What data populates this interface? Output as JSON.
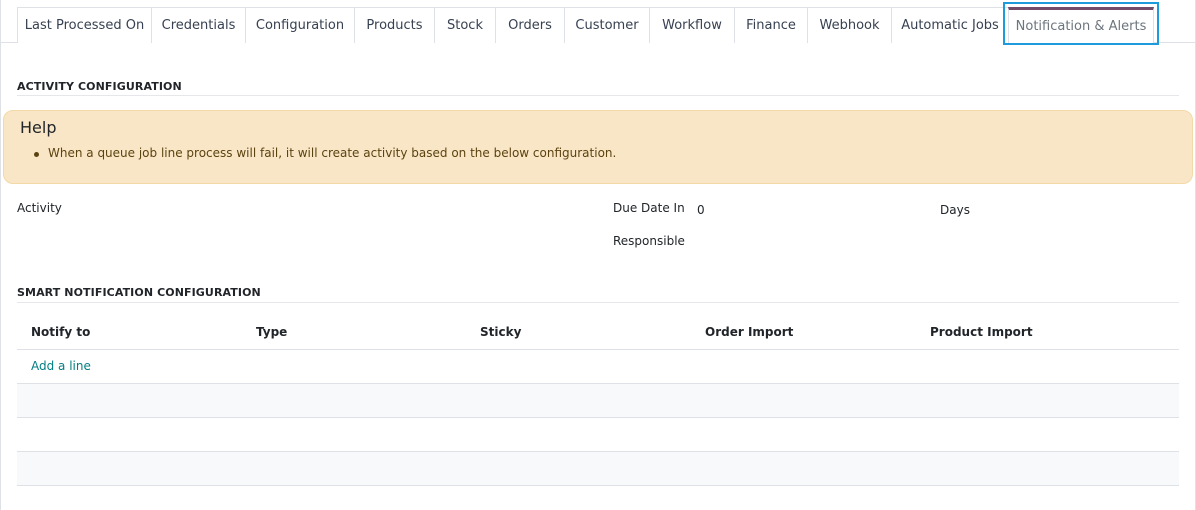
{
  "tabs": [
    {
      "label": "Last Processed On",
      "active": false
    },
    {
      "label": "Credentials",
      "active": false
    },
    {
      "label": "Configuration",
      "active": false
    },
    {
      "label": "Products",
      "active": false
    },
    {
      "label": "Stock",
      "active": false
    },
    {
      "label": "Orders",
      "active": false
    },
    {
      "label": "Customer",
      "active": false
    },
    {
      "label": "Workflow",
      "active": false
    },
    {
      "label": "Finance",
      "active": false
    },
    {
      "label": "Webhook",
      "active": false
    },
    {
      "label": "Automatic Jobs",
      "active": false
    },
    {
      "label": "Notification & Alerts",
      "active": true
    }
  ],
  "activity_section": {
    "title": "ACTIVITY CONFIGURATION",
    "help": {
      "title": "Help",
      "bullet": "When a queue job line process will fail, it will create activity based on the below configuration."
    },
    "activity_label": "Activity",
    "due_date_label": "Due Date In",
    "due_date_value": "0",
    "due_date_unit": "Days",
    "responsible_label": "Responsible"
  },
  "smart_section": {
    "title": "SMART NOTIFICATION CONFIGURATION",
    "columns": [
      "Notify to",
      "Type",
      "Sticky",
      "Order Import",
      "Product Import"
    ],
    "add_line_label": "Add a line"
  },
  "colors": {
    "accent": "#714b67",
    "link": "#017e84",
    "help_bg": "#f9e6c6",
    "highlight": "#1e9bdc"
  }
}
